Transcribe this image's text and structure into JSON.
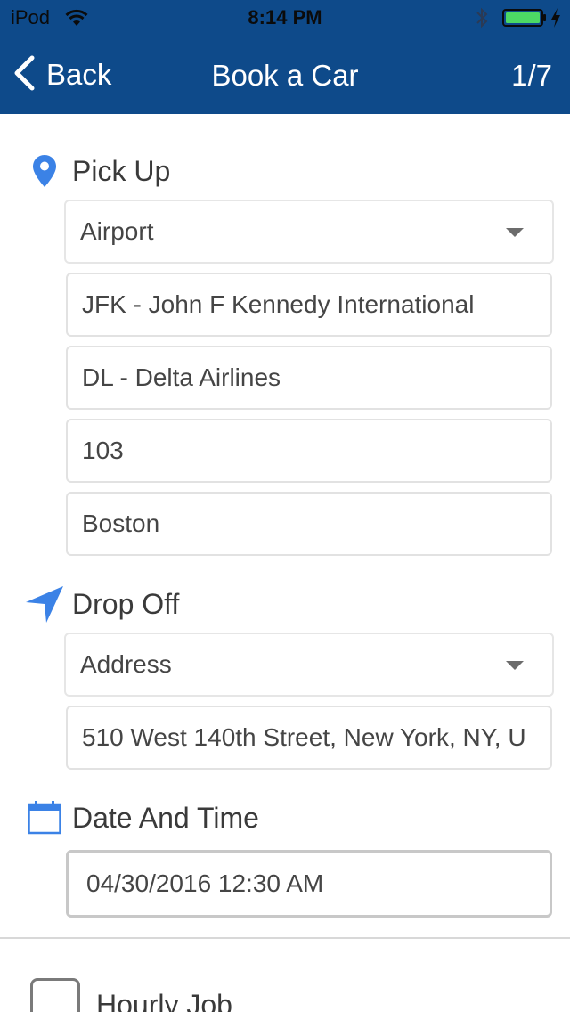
{
  "status_bar": {
    "carrier": "iPod",
    "time": "8:14 PM"
  },
  "nav": {
    "back_label": "Back",
    "title": "Book a Car",
    "step": "1/7"
  },
  "pickup": {
    "title": "Pick Up",
    "type_value": "Airport",
    "airport_value": "JFK - John F Kennedy International",
    "airline_value": "DL - Delta Airlines",
    "flight_value": "103",
    "origin_value": "Boston"
  },
  "dropoff": {
    "title": "Drop Off",
    "type_value": "Address",
    "address_value": "510 West 140th Street, New York, NY, U"
  },
  "datetime": {
    "title": "Date And Time",
    "value": "04/30/2016 12:30 AM"
  },
  "hourly": {
    "label": "Hourly Job"
  },
  "colors": {
    "nav_bg": "#0e4a8a",
    "icon_blue": "#3b82e6",
    "battery_green": "#4cd964"
  }
}
